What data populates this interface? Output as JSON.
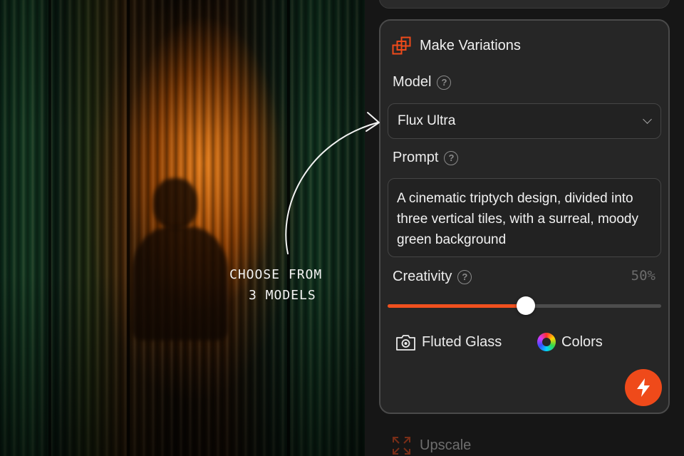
{
  "artwork": {
    "caption_line1": "CHOOSE FROM",
    "caption_line2": "3 MODELS"
  },
  "panel": {
    "title": "Make Variations",
    "title_icon": "stacked-squares-icon",
    "model": {
      "label": "Model",
      "help_icon": "question-icon",
      "selected": "Flux Ultra"
    },
    "prompt": {
      "label": "Prompt",
      "help_icon": "question-icon",
      "value": "A cinematic triptych design, divided into three vertical tiles, with a surreal, moody green background"
    },
    "creativity": {
      "label": "Creativity",
      "help_icon": "question-icon",
      "value_text": "50%",
      "level": 0.5
    },
    "styles": [
      {
        "label": "Fluted Glass",
        "icon": "camera-icon"
      },
      {
        "label": "Colors",
        "icon": "color-wheel-icon"
      }
    ],
    "generate_icon": "lightning-bolt-icon"
  },
  "next_section": {
    "title": "Upscale",
    "icon": "expand-arrows-icon"
  },
  "colors": {
    "accent": "#ef4a1a",
    "panel_bg": "#262626",
    "border": "#4a4a4a"
  }
}
